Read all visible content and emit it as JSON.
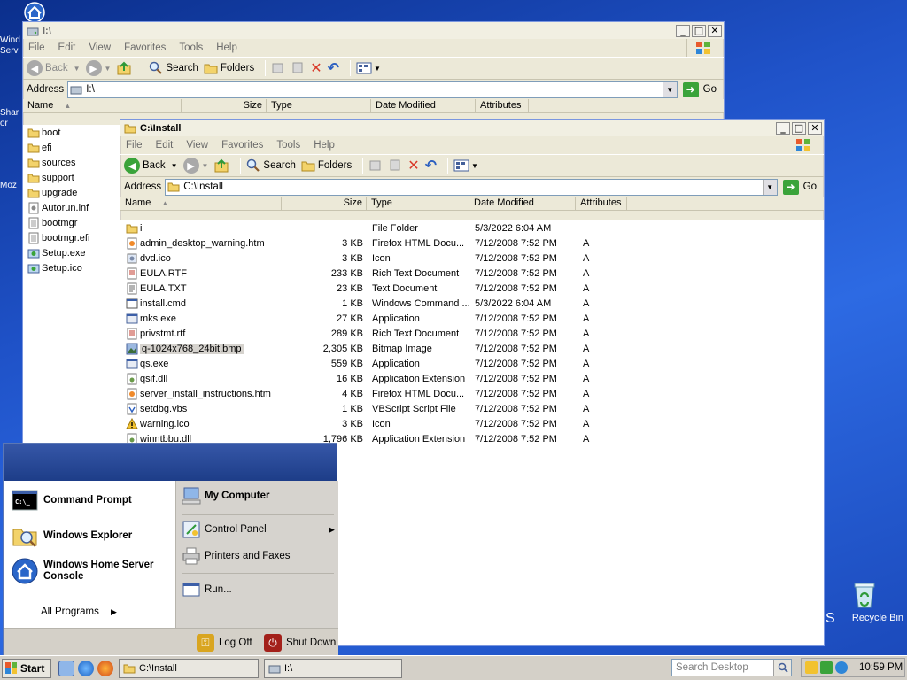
{
  "desktop": {
    "left_labels": [
      "Wind",
      "Serv",
      "Shar",
      "or",
      "Moz"
    ],
    "recycle_label": "Recycle Bin",
    "recycle_prefix": "S"
  },
  "win_i": {
    "title": "I:\\",
    "menu": [
      "File",
      "Edit",
      "View",
      "Favorites",
      "Tools",
      "Help"
    ],
    "toolbar": {
      "back": "Back",
      "search": "Search",
      "folders": "Folders"
    },
    "address_label": "Address",
    "address_value": "I:\\",
    "go": "Go",
    "columns": [
      "Name",
      "Size",
      "Type",
      "Date Modified",
      "Attributes"
    ],
    "files": [
      {
        "name": "boot",
        "icon": "folder"
      },
      {
        "name": "efi",
        "icon": "folder"
      },
      {
        "name": "sources",
        "icon": "folder"
      },
      {
        "name": "support",
        "icon": "folder"
      },
      {
        "name": "upgrade",
        "icon": "folder"
      },
      {
        "name": "Autorun.inf",
        "icon": "inf"
      },
      {
        "name": "bootmgr",
        "icon": "sys"
      },
      {
        "name": "bootmgr.efi",
        "icon": "sys"
      },
      {
        "name": "Setup.exe",
        "icon": "setup"
      },
      {
        "name": "Setup.ico",
        "icon": "setup"
      }
    ]
  },
  "win_install": {
    "title": "C:\\Install",
    "menu": [
      "File",
      "Edit",
      "View",
      "Favorites",
      "Tools",
      "Help"
    ],
    "toolbar": {
      "back": "Back",
      "search": "Search",
      "folders": "Folders"
    },
    "address_label": "Address",
    "address_value": "C:\\Install",
    "go": "Go",
    "columns": [
      "Name",
      "Size",
      "Type",
      "Date Modified",
      "Attributes"
    ],
    "files": [
      {
        "name": "i",
        "size": "",
        "type": "File Folder",
        "date": "5/3/2022 6:04 AM",
        "attr": "",
        "icon": "folder"
      },
      {
        "name": "admin_desktop_warning.htm",
        "size": "3 KB",
        "type": "Firefox HTML Docu...",
        "date": "7/12/2008 7:52 PM",
        "attr": "A",
        "icon": "htm"
      },
      {
        "name": "dvd.ico",
        "size": "3 KB",
        "type": "Icon",
        "date": "7/12/2008 7:52 PM",
        "attr": "A",
        "icon": "ico"
      },
      {
        "name": "EULA.RTF",
        "size": "233 KB",
        "type": "Rich Text Document",
        "date": "7/12/2008 7:52 PM",
        "attr": "A",
        "icon": "rtf"
      },
      {
        "name": "EULA.TXT",
        "size": "23 KB",
        "type": "Text Document",
        "date": "7/12/2008 7:52 PM",
        "attr": "A",
        "icon": "txt"
      },
      {
        "name": "install.cmd",
        "size": "1 KB",
        "type": "Windows Command ...",
        "date": "5/3/2022 6:04 AM",
        "attr": "A",
        "icon": "cmd"
      },
      {
        "name": "mks.exe",
        "size": "27 KB",
        "type": "Application",
        "date": "7/12/2008 7:52 PM",
        "attr": "A",
        "icon": "exe"
      },
      {
        "name": "privstmt.rtf",
        "size": "289 KB",
        "type": "Rich Text Document",
        "date": "7/12/2008 7:52 PM",
        "attr": "A",
        "icon": "rtf"
      },
      {
        "name": "q-1024x768_24bit.bmp",
        "size": "2,305 KB",
        "type": "Bitmap Image",
        "date": "7/12/2008 7:52 PM",
        "attr": "A",
        "icon": "bmp"
      },
      {
        "name": "qs.exe",
        "size": "559 KB",
        "type": "Application",
        "date": "7/12/2008 7:52 PM",
        "attr": "A",
        "icon": "exe"
      },
      {
        "name": "qsif.dll",
        "size": "16 KB",
        "type": "Application Extension",
        "date": "7/12/2008 7:52 PM",
        "attr": "A",
        "icon": "dll"
      },
      {
        "name": "server_install_instructions.htm",
        "size": "4 KB",
        "type": "Firefox HTML Docu...",
        "date": "7/12/2008 7:52 PM",
        "attr": "A",
        "icon": "htm"
      },
      {
        "name": "setdbg.vbs",
        "size": "1 KB",
        "type": "VBScript Script File",
        "date": "7/12/2008 7:52 PM",
        "attr": "A",
        "icon": "vbs"
      },
      {
        "name": "warning.ico",
        "size": "3 KB",
        "type": "Icon",
        "date": "7/12/2008 7:52 PM",
        "attr": "A",
        "icon": "warn"
      },
      {
        "name": "winntbbu.dll",
        "size": "1,796 KB",
        "type": "Application Extension",
        "date": "7/12/2008 7:52 PM",
        "attr": "A",
        "icon": "dll"
      }
    ],
    "selected_file": "q-1024x768_24bit.bmp"
  },
  "start_menu": {
    "left_items": [
      "Command Prompt",
      "Windows Explorer",
      "Windows Home Server",
      "Console"
    ],
    "all_programs": "All Programs",
    "right_items": [
      "My Computer",
      "Control Panel",
      "Printers and Faxes",
      "Run..."
    ],
    "log_off": "Log Off",
    "shut_down": "Shut Down"
  },
  "taskbar": {
    "start_label": "Start",
    "items": [
      "C:\\Install",
      "I:\\"
    ],
    "search_placeholder": "Search Desktop",
    "clock": "10:59 PM"
  },
  "colors": {
    "desktop": "#1f52c8",
    "selection": "#d6d3ce",
    "go_green": "#3aa33a",
    "delete_red": "#d93a2a",
    "shutdown_red": "#a3201a",
    "logoff_gold": "#d9a520"
  }
}
